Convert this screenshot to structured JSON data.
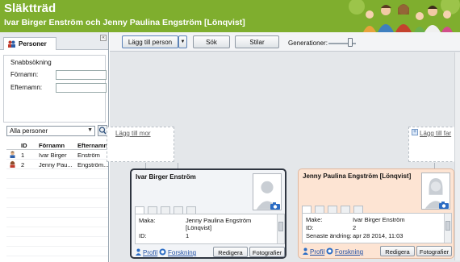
{
  "header": {
    "title": "Släktträd",
    "subtitle": "Ivar Birger Enström och Jenny Paulina Engström [Lönqvist]"
  },
  "sidebar": {
    "tab_label": "Personer",
    "collapse_glyph": "«",
    "quick_search": {
      "title": "Snabbsökning",
      "first_name_label": "Förnamn:",
      "first_name_value": "",
      "last_name_label": "Efternamn:",
      "last_name_value": ""
    },
    "filter": {
      "selected": "Alla personer"
    },
    "table": {
      "columns": [
        "ID",
        "Förnamn",
        "Efternamn"
      ],
      "rows": [
        {
          "id": "1",
          "first": "Ivar Birger",
          "last": "Enström",
          "gender": "male"
        },
        {
          "id": "2",
          "first": "Jenny Pau...",
          "last": "Engström...",
          "gender": "female"
        }
      ]
    }
  },
  "toolbar": {
    "add_person": "Lägg till person",
    "search": "Sök",
    "styles": "Stilar",
    "generations_label": "Generationer:",
    "generations_level": 0.8
  },
  "tree": {
    "add_mother": "Lägg till mor",
    "add_father": "Lägg till far",
    "persons": [
      {
        "name": "Ivar Birger Enström",
        "gender": "male",
        "details": [
          {
            "label": "Maka:",
            "value": "Jenny Paulina Engström"
          },
          {
            "label": "",
            "value": "[Lönqvist]"
          },
          {
            "label": "ID:",
            "value": "1"
          }
        ],
        "profile": "Profil",
        "research": "Forskning",
        "edit": "Redigera",
        "photos": "Fotografier"
      },
      {
        "name": "Jenny Paulina Engström [Lönqvist]",
        "gender": "female",
        "details": [
          {
            "label": "Make:",
            "value": "Ivar Birger Enström"
          },
          {
            "label": "ID:",
            "value": "2"
          },
          {
            "label": "Senaste ändring:",
            "value": "apr 28 2014, 11:03"
          }
        ],
        "profile": "Profil",
        "research": "Forskning",
        "edit": "Redigera",
        "photos": "Fotografier"
      }
    ]
  },
  "colors": {
    "header_green": "#7fae2e",
    "male_card": "#f2f4f7",
    "female_card": "#fde4d3",
    "link_blue": "#1f4fa5"
  }
}
